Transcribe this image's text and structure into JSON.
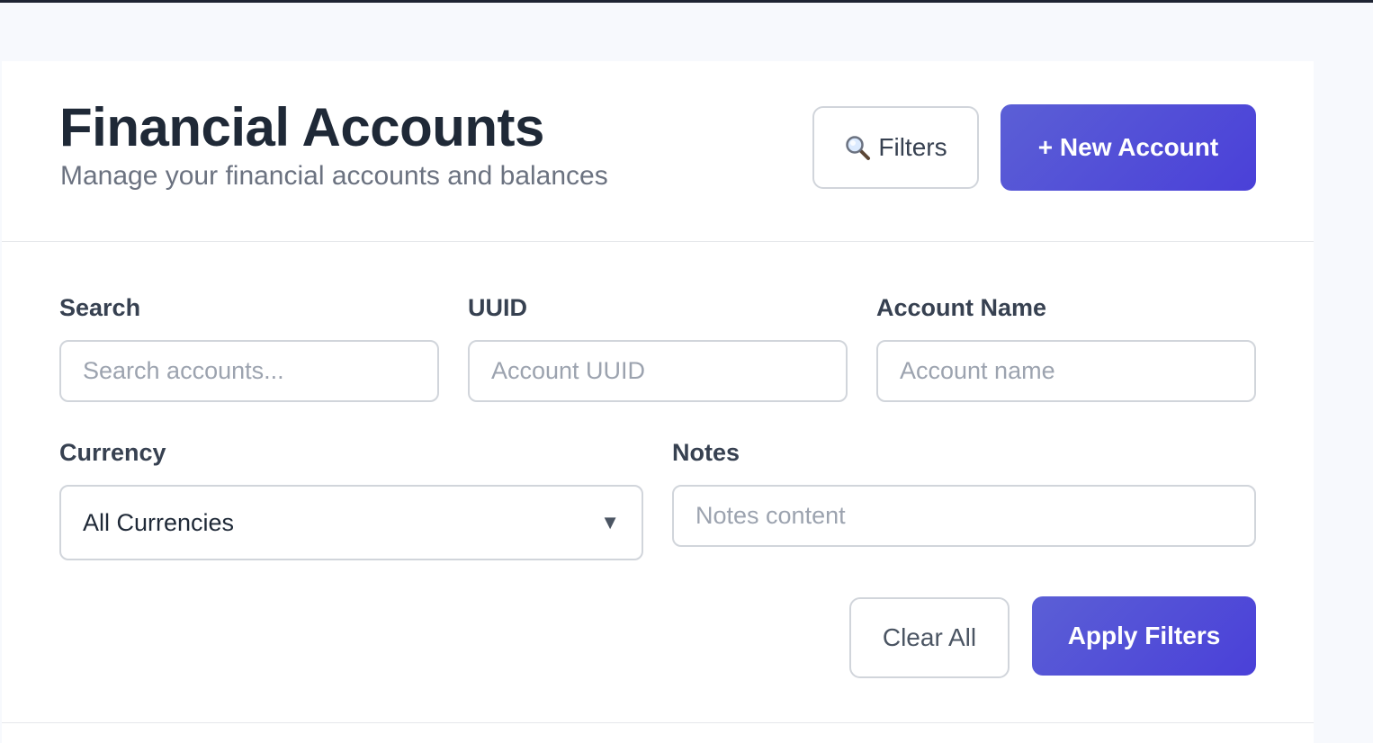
{
  "header": {
    "title": "Financial Accounts",
    "subtitle": "Manage your financial accounts and balances",
    "filters_button": "Filters",
    "new_account_button": "+ New Account"
  },
  "filters": {
    "search": {
      "label": "Search",
      "placeholder": "Search accounts...",
      "value": ""
    },
    "uuid": {
      "label": "UUID",
      "placeholder": "Account UUID",
      "value": ""
    },
    "account_name": {
      "label": "Account Name",
      "placeholder": "Account name",
      "value": ""
    },
    "currency": {
      "label": "Currency",
      "selected": "All Currencies"
    },
    "notes": {
      "label": "Notes",
      "placeholder": "Notes content",
      "value": ""
    },
    "clear_button": "Clear All",
    "apply_button": "Apply Filters"
  },
  "icons": {
    "filters": "magnifier-icon",
    "currency_caret": "caret-down-icon"
  },
  "colors": {
    "accent": "#4f46e5",
    "title": "#1f2937",
    "muted": "#6b7280",
    "border": "#d1d5db",
    "page_background": "#f7f9fd"
  }
}
